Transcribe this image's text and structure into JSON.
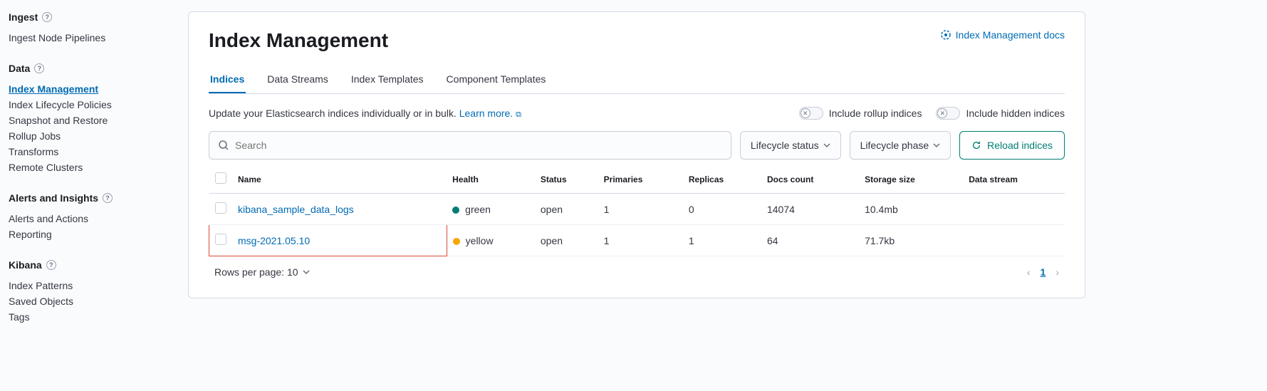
{
  "sidebar": {
    "sections": [
      {
        "heading": "Ingest",
        "items": [
          {
            "label": "Ingest Node Pipelines",
            "active": false
          }
        ]
      },
      {
        "heading": "Data",
        "items": [
          {
            "label": "Index Management",
            "active": true
          },
          {
            "label": "Index Lifecycle Policies",
            "active": false
          },
          {
            "label": "Snapshot and Restore",
            "active": false
          },
          {
            "label": "Rollup Jobs",
            "active": false
          },
          {
            "label": "Transforms",
            "active": false
          },
          {
            "label": "Remote Clusters",
            "active": false
          }
        ]
      },
      {
        "heading": "Alerts and Insights",
        "items": [
          {
            "label": "Alerts and Actions",
            "active": false
          },
          {
            "label": "Reporting",
            "active": false
          }
        ]
      },
      {
        "heading": "Kibana",
        "items": [
          {
            "label": "Index Patterns",
            "active": false
          },
          {
            "label": "Saved Objects",
            "active": false
          },
          {
            "label": "Tags",
            "active": false
          }
        ]
      }
    ]
  },
  "header": {
    "title": "Index Management",
    "docs_link": "Index Management docs"
  },
  "tabs": [
    {
      "label": "Indices",
      "active": true
    },
    {
      "label": "Data Streams",
      "active": false
    },
    {
      "label": "Index Templates",
      "active": false
    },
    {
      "label": "Component Templates",
      "active": false
    }
  ],
  "description": {
    "text": "Update your Elasticsearch indices individually or in bulk. ",
    "learn_more": "Learn more."
  },
  "toggles": {
    "rollup": "Include rollup indices",
    "hidden": "Include hidden indices"
  },
  "filters": {
    "search_placeholder": "Search",
    "lifecycle_status": "Lifecycle status",
    "lifecycle_phase": "Lifecycle phase",
    "reload": "Reload indices"
  },
  "table": {
    "columns": {
      "name": "Name",
      "health": "Health",
      "status": "Status",
      "primaries": "Primaries",
      "replicas": "Replicas",
      "docs": "Docs count",
      "storage": "Storage size",
      "stream": "Data stream"
    },
    "rows": [
      {
        "name": "kibana_sample_data_logs",
        "health": "green",
        "health_color": "green",
        "status": "open",
        "primaries": "1",
        "replicas": "0",
        "docs": "14074",
        "storage": "10.4mb",
        "stream": "",
        "highlighted": false
      },
      {
        "name": "msg-2021.05.10",
        "health": "yellow",
        "health_color": "yellow",
        "status": "open",
        "primaries": "1",
        "replicas": "1",
        "docs": "64",
        "storage": "71.7kb",
        "stream": "",
        "highlighted": true
      }
    ]
  },
  "footer": {
    "rows_label": "Rows per page: 10",
    "current_page": "1"
  }
}
